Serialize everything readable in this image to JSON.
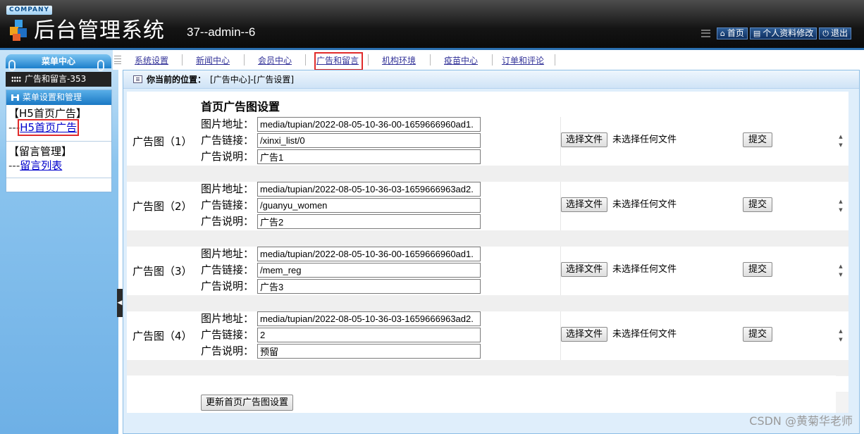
{
  "header": {
    "company": "COMPANY",
    "title": "后台管理系统",
    "user_info": "37--admin--6",
    "links": [
      {
        "icon": "home-icon",
        "label": "首页"
      },
      {
        "icon": "profile-icon",
        "label": "个人资料修改"
      },
      {
        "icon": "power-icon",
        "label": "退出"
      }
    ]
  },
  "sidebar": {
    "menu_center": "菜单中心",
    "count_label": "广告和留言-353",
    "box_title": "菜单设置和管理",
    "groups": [
      {
        "title": "【H5首页广告】",
        "prefix": "---",
        "link": "H5首页广告"
      },
      {
        "title": "【留言管理】",
        "prefix": "---",
        "link": "留言列表"
      }
    ]
  },
  "nav": {
    "tabs": [
      "系统设置",
      "新闻中心",
      "会员中心",
      "广告和留言",
      "机构环境",
      "疫苗中心",
      "订单和评论"
    ],
    "active": "广告和留言"
  },
  "breadcrumb": {
    "label": "你当前的位置：",
    "path": "[广告中心]-[广告设置]"
  },
  "form": {
    "section_title": "首页广告图设置",
    "field_labels": {
      "image": "图片地址：",
      "link": "广告链接：",
      "desc": "广告说明："
    },
    "choose_file": "选择文件",
    "no_file": "未选择任何文件",
    "submit": "提交",
    "update_button": "更新首页广告图设置",
    "ads": [
      {
        "label": "广告图（1）",
        "image": "media/tupian/2022-08-05-10-36-00-1659666960ad1.",
        "link": "/xinxi_list/0",
        "desc": "广告1"
      },
      {
        "label": "广告图（2）",
        "image": "media/tupian/2022-08-05-10-36-03-1659666963ad2.",
        "link": "/guanyu_women",
        "desc": "广告2"
      },
      {
        "label": "广告图（3）",
        "image": "media/tupian/2022-08-05-10-36-00-1659666960ad1.",
        "link": "/mem_reg",
        "desc": "广告3"
      },
      {
        "label": "广告图（4）",
        "image": "media/tupian/2022-08-05-10-36-03-1659666963ad2.",
        "link": "2",
        "desc": "预留"
      }
    ]
  },
  "watermark": "CSDN @黄菊华老师"
}
